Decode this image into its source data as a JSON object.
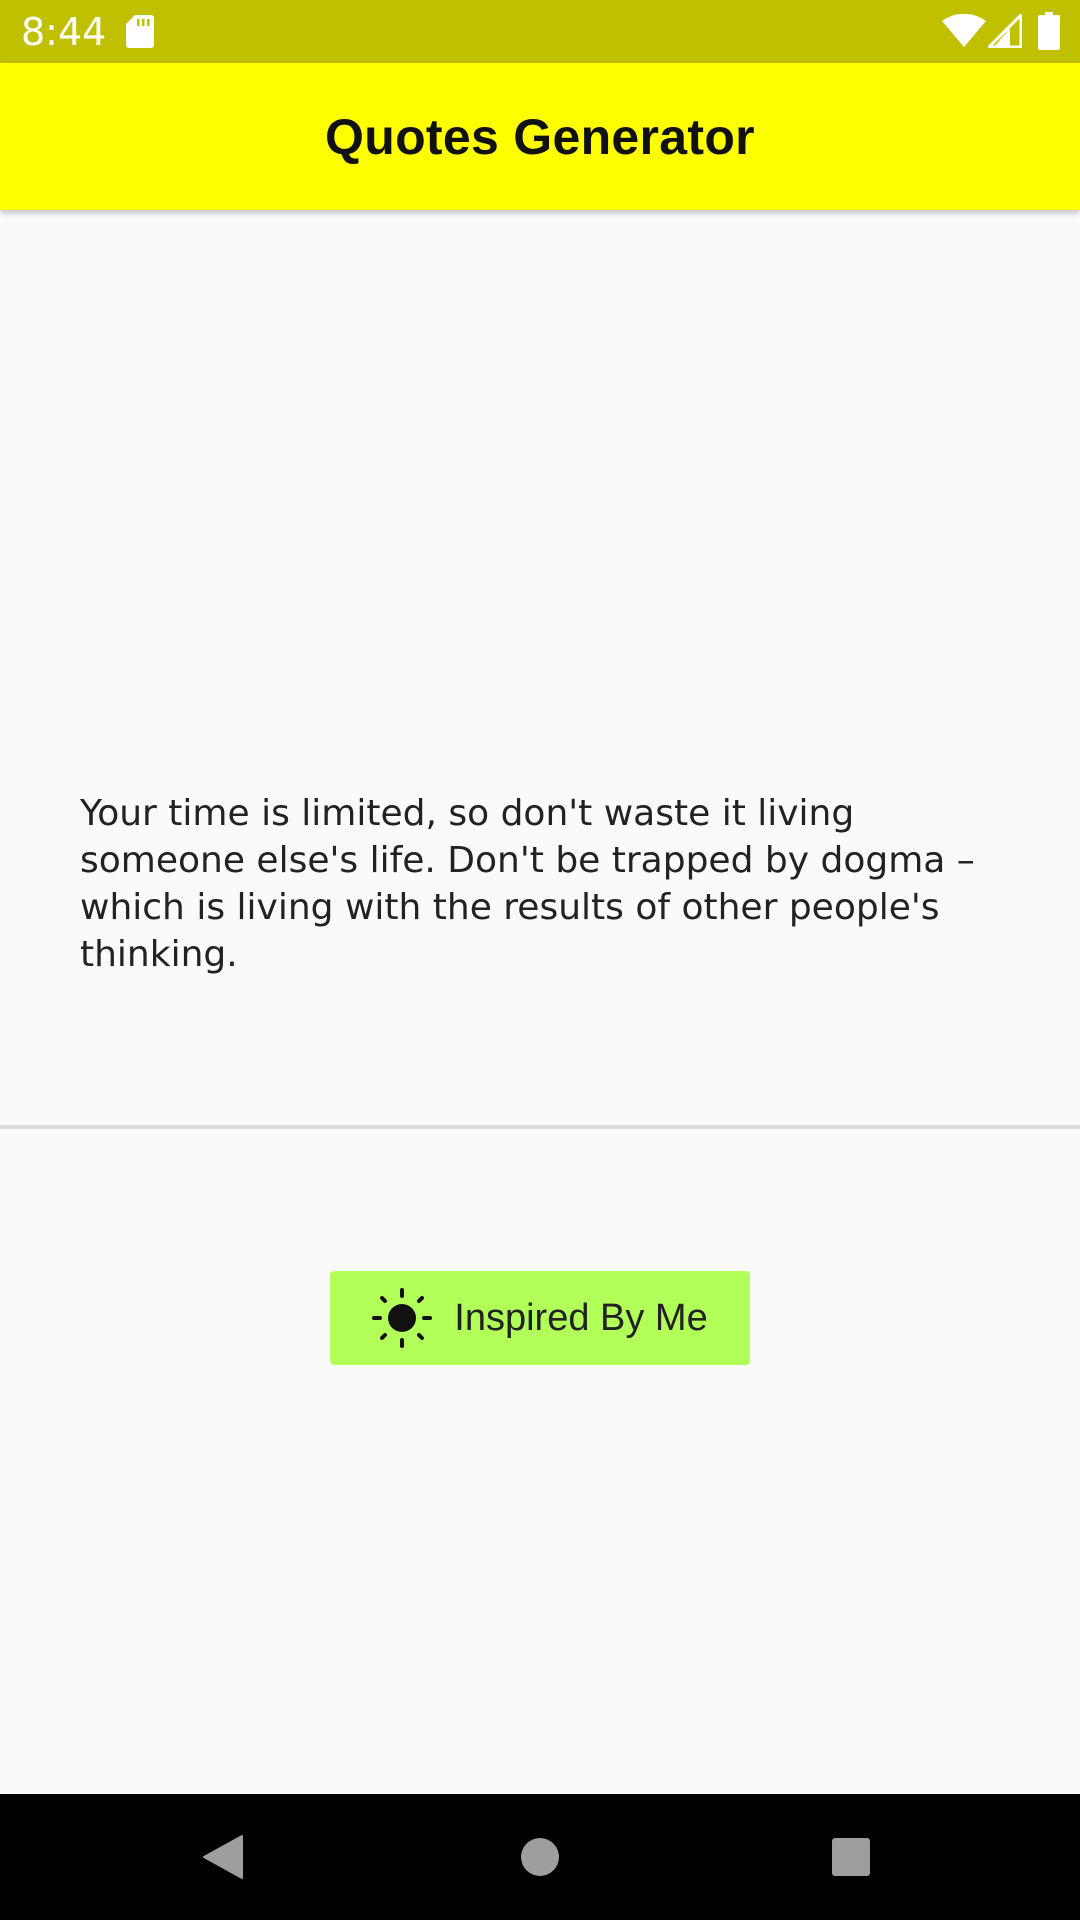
{
  "status_bar": {
    "time": "8:44",
    "icons": [
      "sd-card-icon",
      "wifi-icon",
      "signal-icon",
      "battery-icon"
    ],
    "background": "#c0c000"
  },
  "app_bar": {
    "title": "Quotes Generator",
    "background": "#ffff00"
  },
  "quote": {
    "text": "Your time is limited, so don't waste it living someone else's life. Don't be trapped by dogma – which is living with the results of other people's thinking."
  },
  "button": {
    "label": "Inspired By Me",
    "icon": "sun-icon",
    "background": "#b2ff59"
  },
  "nav_bar": {
    "items": [
      "back-icon",
      "home-icon",
      "recents-icon"
    ]
  }
}
